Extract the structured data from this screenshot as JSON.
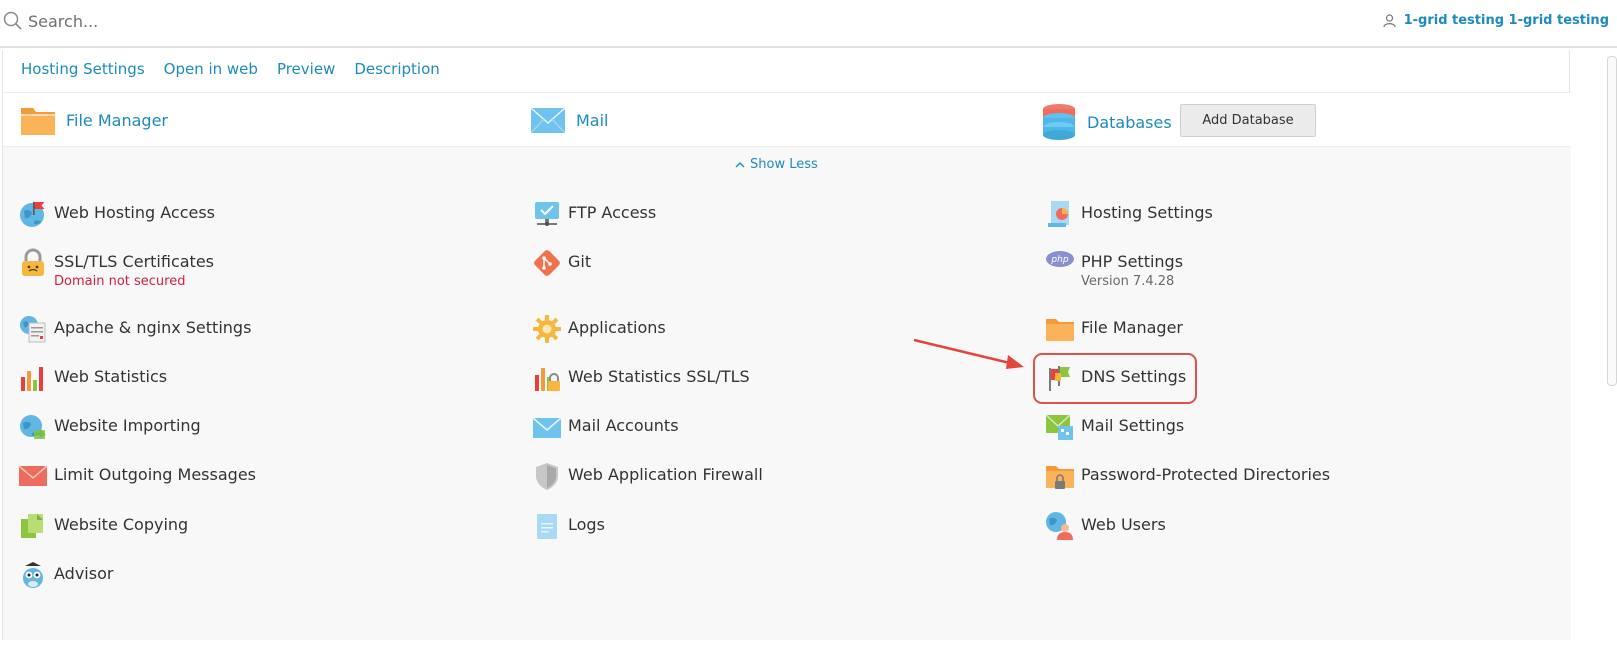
{
  "search": {
    "placeholder": "Search..."
  },
  "user": {
    "name": "1-grid testing 1-grid testing"
  },
  "links": [
    "Hosting Settings",
    "Open in web",
    "Preview",
    "Description"
  ],
  "quick": {
    "file_manager": "File Manager",
    "mail": "Mail",
    "databases": "Databases",
    "add_database": "Add Database"
  },
  "show_less": "Show Less",
  "tools": {
    "web_hosting_access": "Web Hosting Access",
    "ssl": "SSL/TLS Certificates",
    "ssl_status": "Domain not secured",
    "apache": "Apache & nginx Settings",
    "web_statistics": "Web Statistics",
    "website_importing": "Website Importing",
    "limit_outgoing": "Limit Outgoing Messages",
    "website_copying": "Website Copying",
    "advisor": "Advisor",
    "ftp_access": "FTP Access",
    "git": "Git",
    "applications": "Applications",
    "web_stats_ssl": "Web Statistics SSL/TLS",
    "mail_accounts": "Mail Accounts",
    "waf": "Web Application Firewall",
    "logs": "Logs",
    "hosting_settings": "Hosting Settings",
    "php_settings": "PHP Settings",
    "php_version": "Version 7.4.28",
    "file_manager": "File Manager",
    "dns_settings": "DNS Settings",
    "mail_settings": "Mail Settings",
    "password_dirs": "Password-Protected Directories",
    "web_users": "Web Users"
  },
  "colors": {
    "link": "#1d8bbf",
    "danger": "#d4213f",
    "highlight": "#d9534f"
  }
}
